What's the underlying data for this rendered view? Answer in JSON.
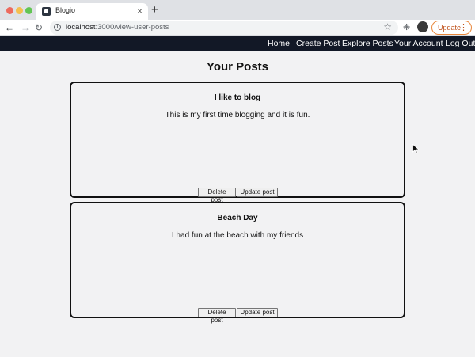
{
  "browser": {
    "tab_title": "Blogio",
    "tab_close": "×",
    "new_tab": "+",
    "url_host": "localhost",
    "url_path": ":3000/view-user-posts",
    "update_label": "Update",
    "icons": [
      "back-arrow-icon",
      "forward-arrow-icon",
      "reload-icon",
      "info-icon",
      "star-icon",
      "extensions-icon",
      "profile-avatar",
      "more-icon"
    ]
  },
  "nav": {
    "home": "Home",
    "create_post": "Create Post",
    "explore_posts": "Explore Posts",
    "your_account": "Your Account",
    "log_out": "Log Out"
  },
  "page": {
    "title": "Your Posts"
  },
  "posts": [
    {
      "title": "I like to blog",
      "body": "This is my first time blogging and it is fun.",
      "delete_label": "Delete post",
      "update_label": "Update post"
    },
    {
      "title": "Beach Day",
      "body": "I had fun at the beach with my friends",
      "delete_label": "Delete post",
      "update_label": "Update post"
    }
  ],
  "colors": {
    "nav_bg": "#121826",
    "page_bg": "#f2f2f3",
    "update_accent": "#e8863a"
  }
}
